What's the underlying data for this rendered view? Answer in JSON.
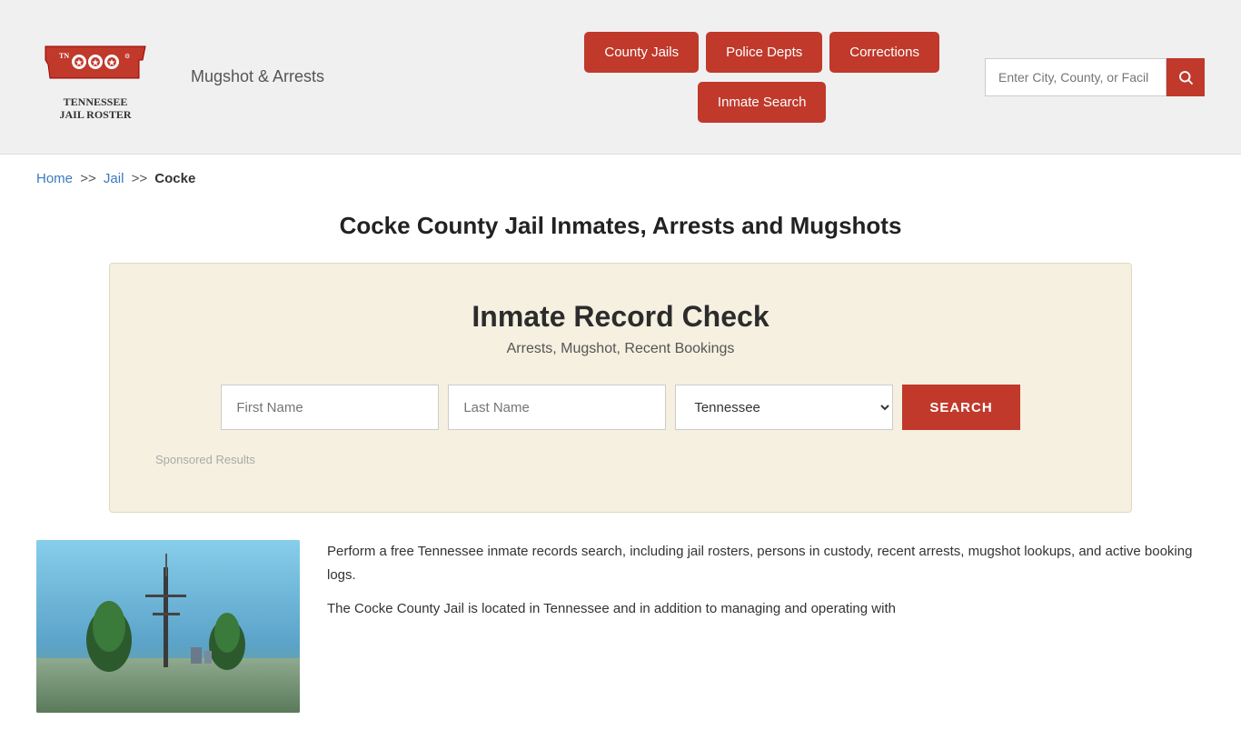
{
  "header": {
    "site_name_line1": "TENNESSEE",
    "site_name_line2": "JAIL ROSTER",
    "mugshot_label": "Mugshot & Arrests",
    "search_placeholder": "Enter City, County, or Facil"
  },
  "nav": {
    "btn1": "County Jails",
    "btn2": "Police Depts",
    "btn3": "Corrections",
    "btn4": "Inmate Search"
  },
  "breadcrumb": {
    "home": "Home",
    "sep1": ">>",
    "jail": "Jail",
    "sep2": ">>",
    "current": "Cocke"
  },
  "page": {
    "title": "Cocke County Jail Inmates, Arrests and Mugshots"
  },
  "record_check": {
    "title": "Inmate Record Check",
    "subtitle": "Arrests, Mugshot, Recent Bookings",
    "first_name_placeholder": "First Name",
    "last_name_placeholder": "Last Name",
    "state_default": "Tennessee",
    "search_btn": "SEARCH",
    "sponsored_label": "Sponsored Results"
  },
  "content": {
    "paragraph1": "Perform a free Tennessee inmate records search, including jail rosters, persons in custody, recent arrests, mugshot lookups, and active booking logs.",
    "paragraph2": "The Cocke County Jail is located in Tennessee and in addition to managing and operating with"
  },
  "colors": {
    "accent": "#c0392b",
    "link": "#3a7abf",
    "bg_box": "#f5f0e0",
    "header_bg": "#f0f0f0"
  }
}
